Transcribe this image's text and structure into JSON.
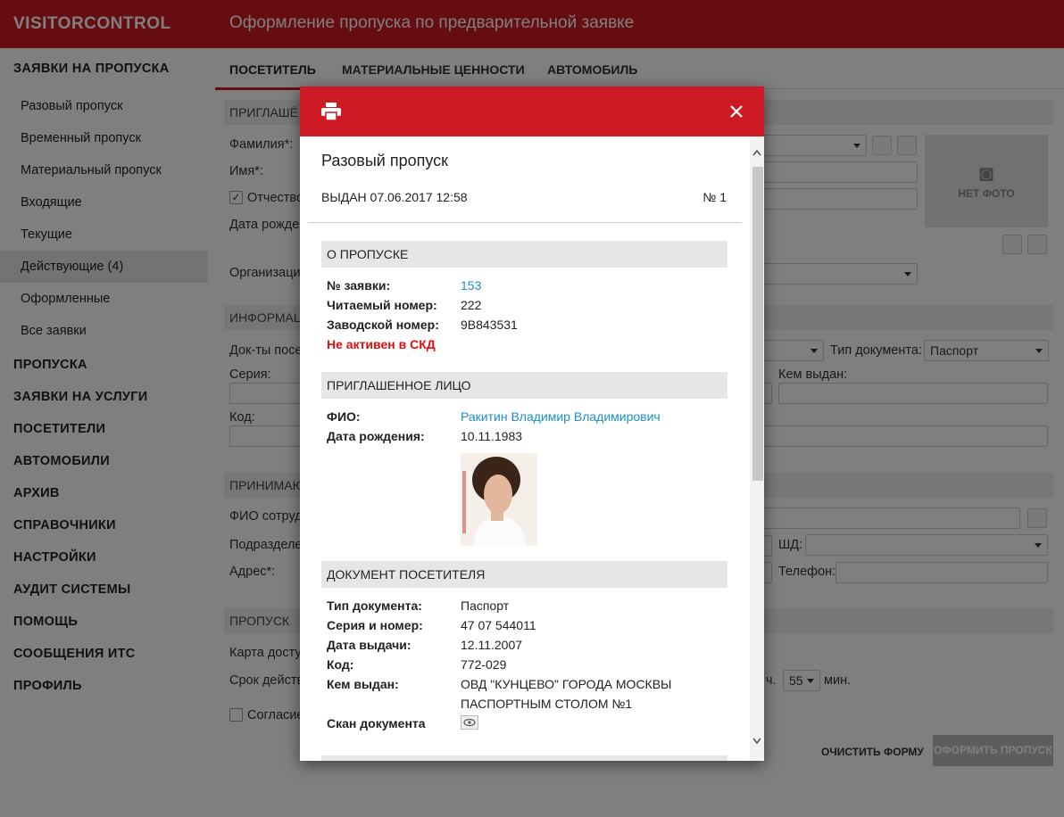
{
  "app": {
    "brand": "VISITORCONTROL",
    "page_title": "Оформление пропуска по предварительной заявке"
  },
  "sidebar": {
    "section_title": "ЗАЯВКИ НА ПРОПУСКА",
    "items": [
      "Разовый пропуск",
      "Временный пропуск",
      "Материальный пропуск",
      "Входящие",
      "Текущие",
      "Действующие (4)",
      "Оформленные",
      "Все заявки"
    ],
    "groups": [
      "ПРОПУСКА",
      "ЗАЯВКИ НА УСЛУГИ",
      "ПОСЕТИТЕЛИ",
      "АВТОМОБИЛИ",
      "АРХИВ",
      "СПРАВОЧНИКИ",
      "НАСТРОЙКИ",
      "АУДИТ СИСТЕМЫ",
      "ПОМОЩЬ",
      "СООБЩЕНИЯ ИТС",
      "ПРОФИЛЬ"
    ]
  },
  "tabs": [
    "ПОСЕТИТЕЛЬ",
    "МАТЕРИАЛЬНЫЕ ЦЕННОСТИ",
    "АВТОМОБИЛЬ"
  ],
  "form": {
    "sec_invited": "ПРИГЛАШЁ",
    "surname": "Фамилия*:",
    "name": "Имя*:",
    "patronymic": "Отчество",
    "birth": "Дата рожде",
    "org": "Организаци",
    "sec_info": "ИНФОРМАЦ",
    "docs": "Док-ты посе",
    "doc_type_label": "Тип документа:",
    "doc_type_value": "Паспорт",
    "series": "Серия:",
    "issued_by": "Кем выдан:",
    "code": "Код:",
    "sec_host": "ПРИНИМАЮ",
    "employee": "ФИО сотруд",
    "dept": "Подразделе",
    "sd": "ШД:",
    "address": "Адрес*:",
    "phone": "Телефон:",
    "sec_pass": "ПРОПУСК",
    "card": "Карта досту",
    "validity": "Срок действ",
    "hours_suffix": "ч.",
    "minutes_value": "55",
    "minutes_suffix": "мин.",
    "consent": "Согласие",
    "no_photo": "НЕТ ФОТО",
    "clear_btn": "ОЧИСТИТЬ ФОРМУ",
    "submit_btn": "ОФОРМИТЬ ПРОПУСК"
  },
  "modal": {
    "title": "Разовый пропуск",
    "issued": "ВЫДАН 07.06.2017 12:58",
    "number": "№ 1",
    "sec_pass": "О ПРОПУСКЕ",
    "req_no_label": "№ заявки:",
    "req_no": "153",
    "read_no_label": "Читаемый номер:",
    "read_no": "222",
    "factory_no_label": "Заводской номер:",
    "factory_no": "9B843531",
    "inactive": "Не активен в СКД",
    "sec_person": "ПРИГЛАШЕННОЕ ЛИЦО",
    "fio_label": "ФИО:",
    "fio": "Ракитин Владимир Владимирович",
    "dob_label": "Дата рождения:",
    "dob": "10.11.1983",
    "sec_doc": "ДОКУМЕНТ ПОСЕТИТЕЛЯ",
    "dtype_label": "Тип документа:",
    "dtype": "Паспорт",
    "series_label": "Серия и номер:",
    "series": "47 07 544011",
    "idate_label": "Дата выдачи:",
    "idate": "12.11.2007",
    "code_label": "Код:",
    "code": "772-029",
    "by_label": "Кем выдан:",
    "by_1": "ОВД \"КУНЦЕВО\" ГОРОДА МОСКВЫ",
    "by_2": "ПАСПОРТНЫМ СТОЛОМ №1",
    "scan_label": "Скан документа"
  }
}
